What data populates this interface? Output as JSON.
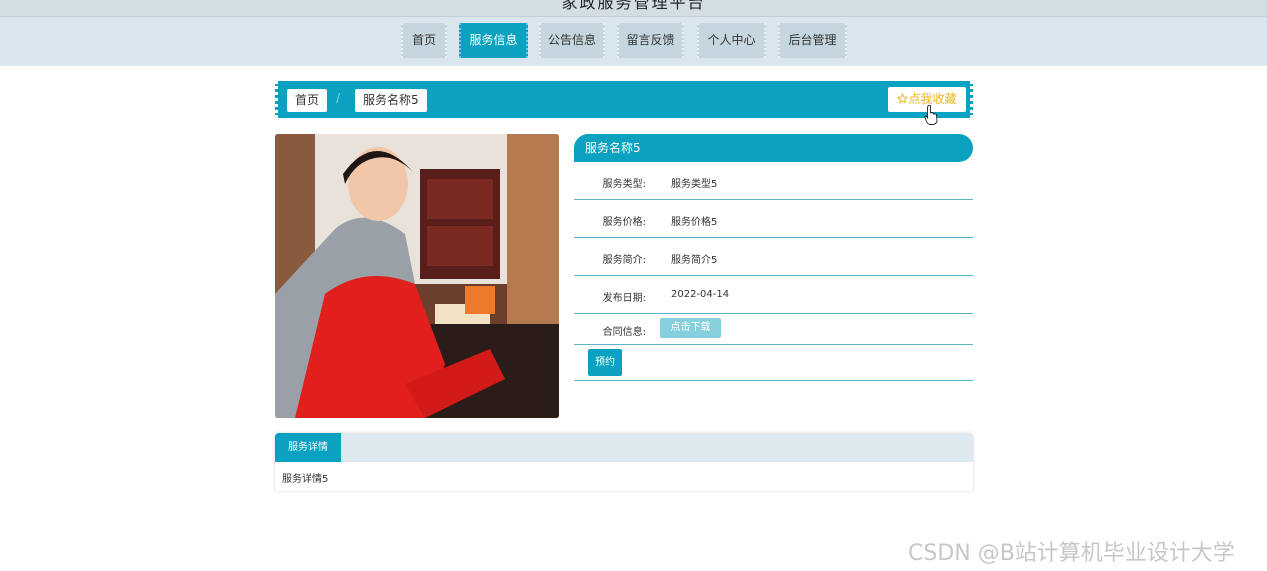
{
  "header": {
    "site_title": "家政服务管理平台"
  },
  "nav": {
    "items": [
      {
        "label": "首页"
      },
      {
        "label": "服务信息"
      },
      {
        "label": "公告信息"
      },
      {
        "label": "留言反馈"
      },
      {
        "label": "个人中心"
      },
      {
        "label": "后台管理"
      }
    ],
    "active_index": 1
  },
  "breadcrumb": {
    "home": "首页",
    "separator": "/",
    "current": "服务名称5",
    "favorite_icon": "star-outline-icon",
    "favorite_label": "点我收藏"
  },
  "service": {
    "image": "housekeeper-cleaning-photo",
    "name": "服务名称5",
    "fields": [
      {
        "label": "服务类型:",
        "value": "服务类型5"
      },
      {
        "label": "服务价格:",
        "value": "服务价格5"
      },
      {
        "label": "服务简介:",
        "value": "服务简介5"
      },
      {
        "label": "发布日期:",
        "value": "2022-04-14"
      }
    ],
    "contract_label": "合同信息:",
    "download_label": "点击下载",
    "book_label": "预约"
  },
  "detail": {
    "tab_label": "服务详情",
    "content": "服务详情5"
  },
  "watermark": "CSDN @B站计算机毕业设计大学",
  "colors": {
    "primary": "#0aa2c0",
    "nav_bg": "#dae6ee",
    "favorite": "#f0b41b"
  }
}
